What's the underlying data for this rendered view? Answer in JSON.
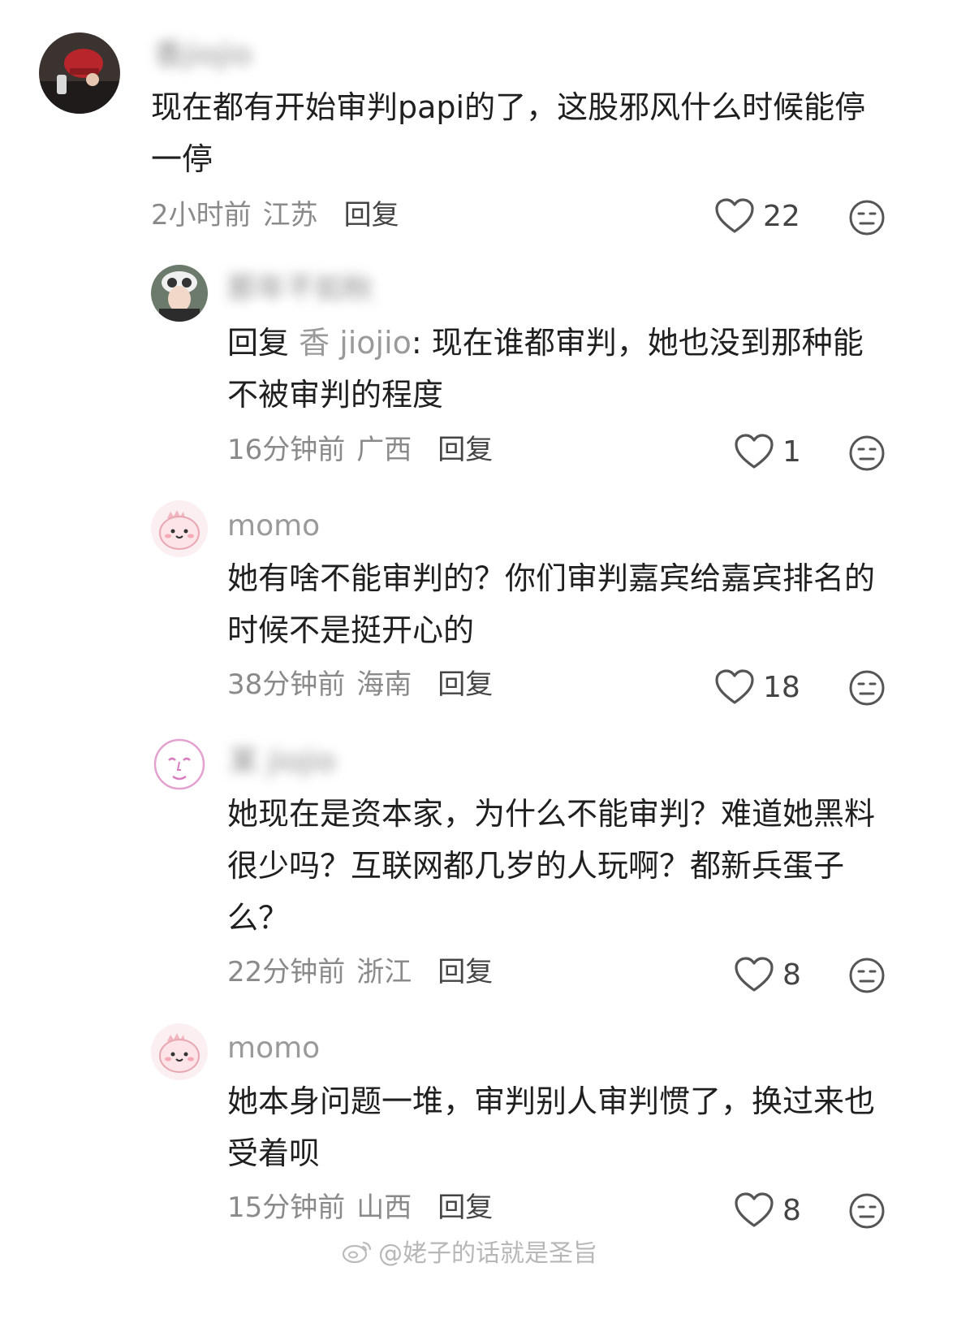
{
  "comments": [
    {
      "username": "香jiojio",
      "text": "现在都有开始审判papi的了，这股邪风什么时候能停一停",
      "time": "2小时前",
      "region": "江苏",
      "reply_label": "回复",
      "likes": "22"
    },
    {
      "username": "那年不如秋",
      "reply_prefix": "回复",
      "reply_target": "香 jiojio",
      "text": ": 现在谁都审判，她也没到那种能不被审判的程度",
      "time": "16分钟前",
      "region": "广西",
      "reply_label": "回复",
      "likes": "1"
    },
    {
      "username": "momo",
      "text": "她有啥不能审判的？你们审判嘉宾给嘉宾排名的时候不是挺开心的",
      "time": "38分钟前",
      "region": "海南",
      "reply_label": "回复",
      "likes": "18"
    },
    {
      "username": "某 jiojio",
      "text": "她现在是资本家，为什么不能审判？难道她黑料很少吗？互联网都几岁的人玩啊？都新兵蛋子么？",
      "time": "22分钟前",
      "region": "浙江",
      "reply_label": "回复",
      "likes": "8"
    },
    {
      "username": "momo",
      "text": "她本身问题一堆，审判别人审判惯了，换过来也受着呗",
      "time": "15分钟前",
      "region": "山西",
      "reply_label": "回复",
      "likes": "8"
    }
  ],
  "watermark": "@姥子的话就是圣旨",
  "colors": {
    "text": "#1f1f1f",
    "muted": "#8a8a8a",
    "icon": "#555555"
  }
}
